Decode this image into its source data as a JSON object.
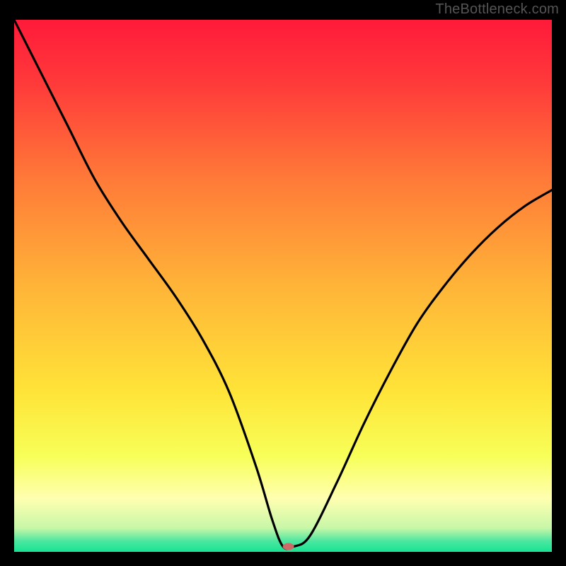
{
  "watermark": "TheBottleneck.com",
  "chart_data": {
    "type": "line",
    "title": "",
    "xlabel": "",
    "ylabel": "",
    "xlim": [
      0,
      100
    ],
    "ylim": [
      0,
      100
    ],
    "grid": false,
    "legend": false,
    "background_gradient": {
      "stops": [
        {
          "offset": 0.0,
          "color": "#ff1a3a"
        },
        {
          "offset": 0.12,
          "color": "#ff3a3a"
        },
        {
          "offset": 0.3,
          "color": "#ff7a38"
        },
        {
          "offset": 0.5,
          "color": "#ffb438"
        },
        {
          "offset": 0.7,
          "color": "#ffe438"
        },
        {
          "offset": 0.82,
          "color": "#f7ff58"
        },
        {
          "offset": 0.9,
          "color": "#ffffb0"
        },
        {
          "offset": 0.955,
          "color": "#c8f7a8"
        },
        {
          "offset": 0.98,
          "color": "#4be6a0"
        },
        {
          "offset": 1.0,
          "color": "#17e493"
        }
      ]
    },
    "series": [
      {
        "name": "bottleneck-curve",
        "color": "#000000",
        "x": [
          0,
          5,
          10,
          15,
          20,
          25,
          30,
          35,
          40,
          45,
          48,
          50,
          52,
          55,
          60,
          65,
          70,
          75,
          80,
          85,
          90,
          95,
          100
        ],
        "y": [
          100,
          90,
          80,
          70,
          62,
          55,
          48,
          40,
          30,
          16,
          6,
          1,
          1,
          3,
          13,
          24,
          34,
          43,
          50,
          56,
          61,
          65,
          68
        ]
      }
    ],
    "marker": {
      "name": "optimal-point",
      "x": 51,
      "y": 1,
      "color": "#cc6a6a",
      "rx": 8,
      "ry": 5
    }
  }
}
